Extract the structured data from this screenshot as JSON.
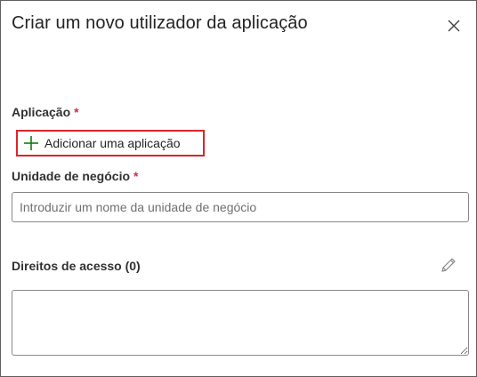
{
  "dialog": {
    "title": "Criar um novo utilizador da aplicação",
    "close_icon": "close-icon"
  },
  "application_field": {
    "label": "Aplicação",
    "required_marker": "*",
    "add_button_label": "Adicionar uma aplicação",
    "add_icon": "plus-icon",
    "highlight_color": "#d8262c"
  },
  "business_unit_field": {
    "label": "Unidade de negócio",
    "required_marker": "*",
    "value": "",
    "placeholder": "Introduzir um nome da unidade de negócio"
  },
  "access_rights": {
    "label": "Direitos de acesso (0)",
    "edit_icon": "pencil-icon",
    "value": ""
  },
  "colors": {
    "required": "#c4314b",
    "plus_icon": "#107c10"
  }
}
